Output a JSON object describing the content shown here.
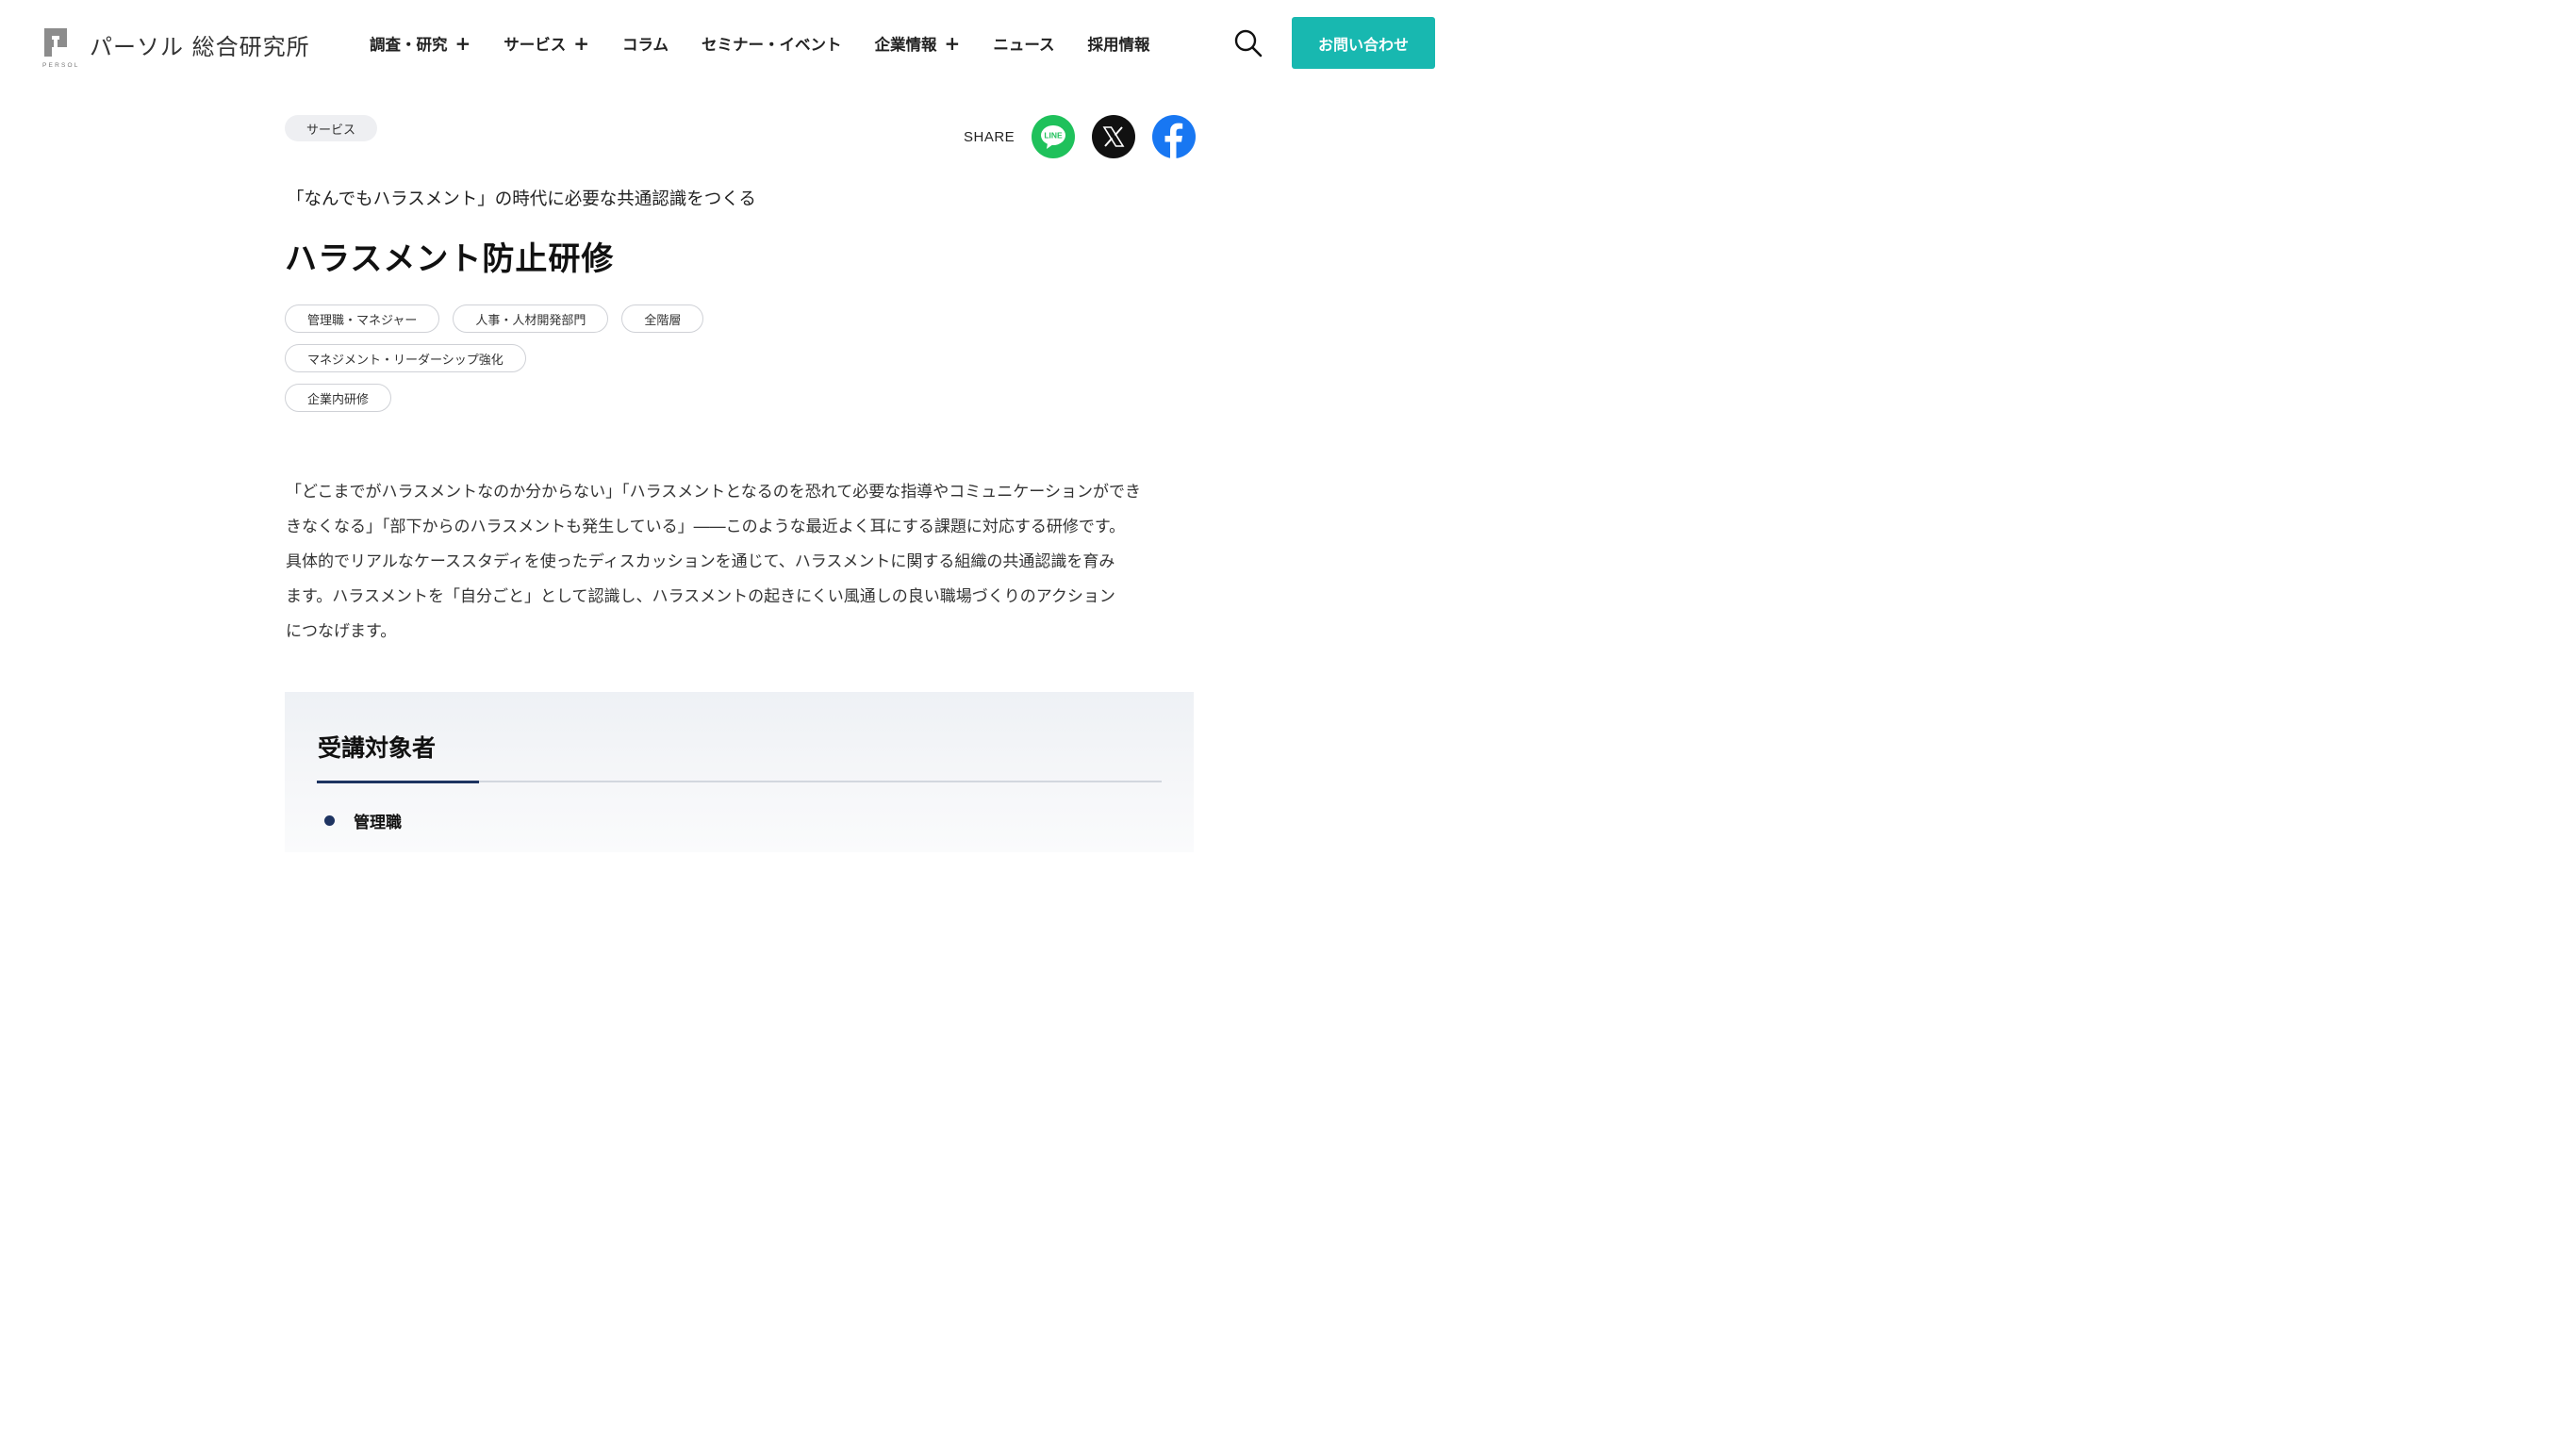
{
  "brand": {
    "name": "パーソル 総合研究所",
    "sub": "PERSOL",
    "mark": "persol-logo-mark"
  },
  "nav": {
    "items": [
      {
        "label": "調査・研究",
        "plus": "+"
      },
      {
        "label": "サービス",
        "plus": "+"
      },
      {
        "label": "コラム",
        "plus": ""
      },
      {
        "label": "セミナー・イベント",
        "plus": ""
      },
      {
        "label": "企業情報",
        "plus": "+"
      },
      {
        "label": "ニュース",
        "plus": ""
      },
      {
        "label": "採用情報",
        "plus": ""
      }
    ],
    "search_icon": "search-icon",
    "contact_label": "お問い合わせ"
  },
  "article": {
    "category": "サービス",
    "share_label": "SHARE",
    "share_icons": [
      "line-icon",
      "x-icon",
      "facebook-icon"
    ],
    "line_icon_text": "LINE",
    "subtitle": "「なんでもハラスメント」の時代に必要な共通認識をつくる",
    "title": "ハラスメント防止研修",
    "tag_rows": [
      [
        "管理職・マネジャー",
        "人事・人材開発部門",
        "全階層"
      ],
      [
        "マネジメント・リーダーシップ強化"
      ],
      [
        "企業内研修"
      ]
    ],
    "intro_lines": [
      "「どこまでがハラスメントなのか分からない」「ハラスメントとなるのを恐れて必要な指導やコミュニケーションができ",
      "きなくなる」「部下からのハラスメントも発生している」――このような最近よく耳にする課題に対応する研修です。",
      "具体的でリアルなケーススタディを使ったディスカッションを通じて、ハラスメントに関する組織の共通認識を育み",
      "ます。ハラスメントを「自分ごと」として認識し、ハラスメントの起きにくい風通しの良い職場づくりのアクション",
      "につなげます。"
    ]
  },
  "target": {
    "title": "受講対象者",
    "items": [
      "管理職"
    ]
  },
  "colors": {
    "accent": "#18b8b0",
    "navy": "#1e3461",
    "line": "#1fc15b",
    "facebook": "#1877f2"
  }
}
